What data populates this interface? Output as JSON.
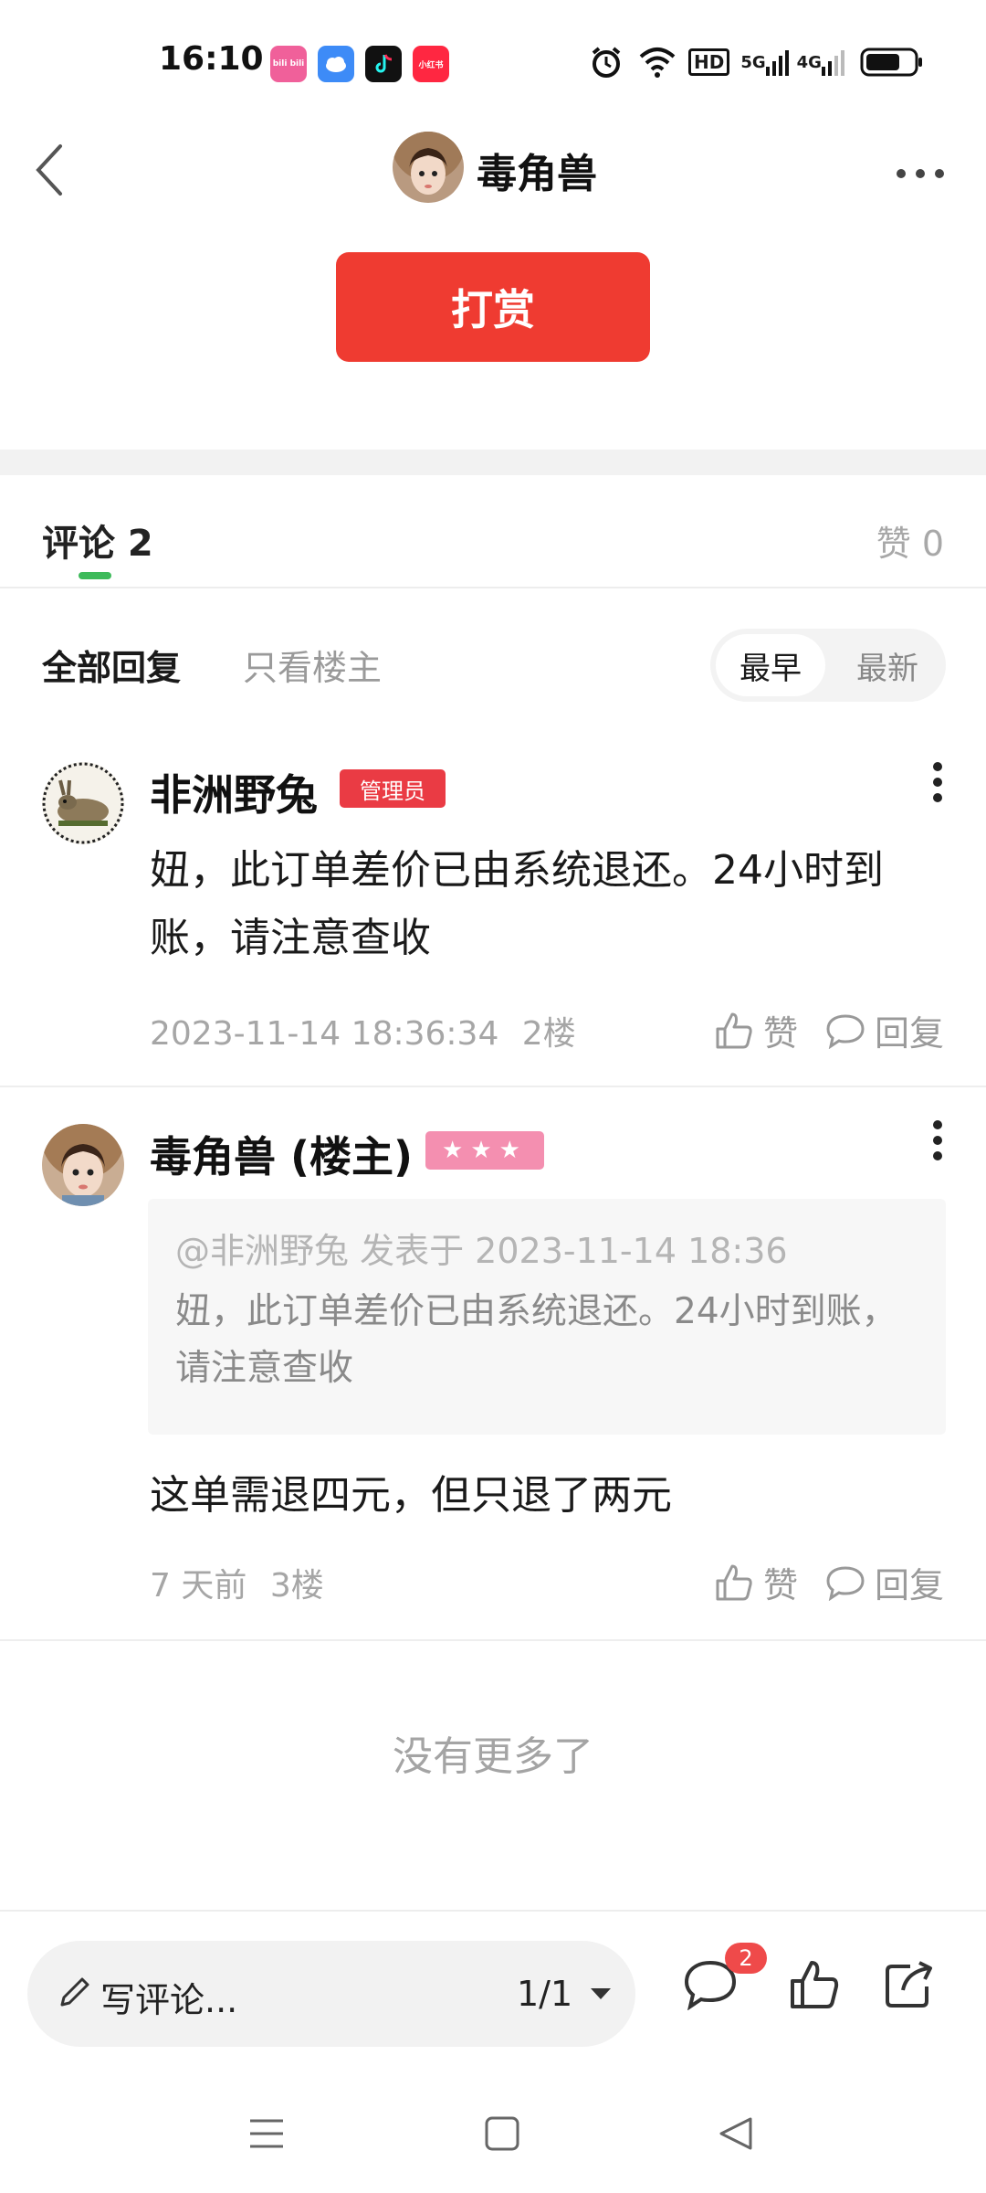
{
  "status_bar": {
    "time": "16:10",
    "app_icons": [
      {
        "name": "bilibili-icon",
        "label": "bili bili",
        "color": "#f0609a"
      },
      {
        "name": "cloud-app-icon",
        "label": "",
        "color": "#3d8bf7"
      },
      {
        "name": "douyin-icon",
        "label": "",
        "color": "#111111"
      },
      {
        "name": "xiaohongshu-icon",
        "label": "小红书",
        "color": "#ff2741"
      }
    ],
    "hd_label": "HD",
    "signal_5g": "5G",
    "signal_4g": "4G"
  },
  "header": {
    "author_name": "毒角兽",
    "more_label": "•••"
  },
  "reward_button": "打赏",
  "tabs": {
    "comments_label": "评论 2",
    "likes_label": "赞 0"
  },
  "filters": {
    "all_replies": "全部回复",
    "op_only": "只看楼主",
    "sort_earliest": "最早",
    "sort_newest": "最新"
  },
  "comments": [
    {
      "author": "非洲野兔",
      "badge": "管理员",
      "text": "妞，此订单差价已由系统退还。24小时到账，请注意查收",
      "time": "2023-11-14 18:36:34",
      "floor": "2楼",
      "like_label": "赞",
      "reply_label": "回复"
    },
    {
      "author": "毒角兽 (楼主)",
      "badge": "★★★",
      "quote_header": "@非洲野兔 发表于 2023-11-14 18:36",
      "quote_text": "妞，此订单差价已由系统退还。24小时到账，请注意查收",
      "text": "这单需退四元，但只退了两元",
      "time": "7 天前",
      "floor": "3楼",
      "like_label": "赞",
      "reply_label": "回复"
    }
  ],
  "no_more": "没有更多了",
  "bottom_bar": {
    "write_placeholder": "写评论...",
    "pager": "1/1",
    "comment_count": "2"
  },
  "colors": {
    "accent_red": "#ef3b31",
    "tab_underline": "#3dba5a",
    "admin_badge": "#ea3b44",
    "stars_badge": "#f48fb0"
  }
}
